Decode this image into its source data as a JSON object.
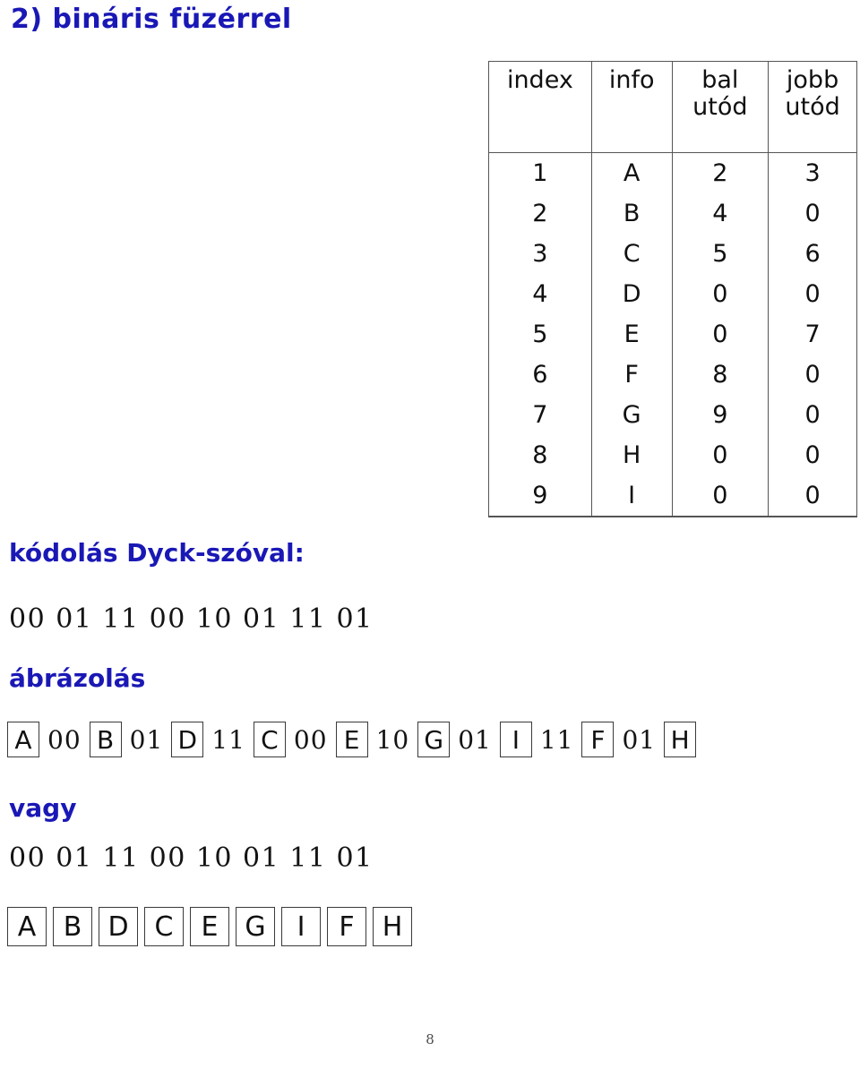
{
  "slide": {
    "title": "2) bináris füzérrel",
    "page_number": "8",
    "accent_color": "#1a18b5",
    "text_color": "#101010"
  },
  "table": {
    "headers": [
      {
        "line1": "index",
        "line2": ""
      },
      {
        "line1": "info",
        "line2": ""
      },
      {
        "line1": "bal",
        "line2": "utód"
      },
      {
        "line1": "jobb",
        "line2": "utód"
      }
    ],
    "rows": [
      {
        "index": "1",
        "info": "A",
        "bal": "2",
        "jobb": "3"
      },
      {
        "index": "2",
        "info": "B",
        "bal": "4",
        "jobb": "0"
      },
      {
        "index": "3",
        "info": "C",
        "bal": "5",
        "jobb": "6"
      },
      {
        "index": "4",
        "info": "D",
        "bal": "0",
        "jobb": "0"
      },
      {
        "index": "5",
        "info": "E",
        "bal": "0",
        "jobb": "7"
      },
      {
        "index": "6",
        "info": "F",
        "bal": "8",
        "jobb": "0"
      },
      {
        "index": "7",
        "info": "G",
        "bal": "9",
        "jobb": "0"
      },
      {
        "index": "8",
        "info": "H",
        "bal": "0",
        "jobb": "0"
      },
      {
        "index": "9",
        "info": "I",
        "bal": "0",
        "jobb": "0"
      }
    ]
  },
  "coding": {
    "heading": "kódolás Dyck-szóval:",
    "dyck_word": "00 01 11 00 10 01 11 01"
  },
  "representation": {
    "heading": "ábrázolás",
    "sequence": [
      {
        "type": "node",
        "value": "A"
      },
      {
        "type": "bits",
        "value": "00"
      },
      {
        "type": "node",
        "value": "B"
      },
      {
        "type": "bits",
        "value": "01"
      },
      {
        "type": "node",
        "value": "D"
      },
      {
        "type": "bits",
        "value": "11"
      },
      {
        "type": "node",
        "value": "C"
      },
      {
        "type": "bits",
        "value": "00"
      },
      {
        "type": "node",
        "value": "E"
      },
      {
        "type": "bits",
        "value": "10"
      },
      {
        "type": "node",
        "value": "G"
      },
      {
        "type": "bits",
        "value": "01"
      },
      {
        "type": "node",
        "value": "I"
      },
      {
        "type": "bits",
        "value": "11"
      },
      {
        "type": "node",
        "value": "F"
      },
      {
        "type": "bits",
        "value": "01"
      },
      {
        "type": "node",
        "value": "H"
      }
    ]
  },
  "alternative": {
    "heading": "vagy",
    "dyck_word": "00 01 11 00 10 01 11 01",
    "nodes": [
      "A",
      "B",
      "D",
      "C",
      "E",
      "G",
      "I",
      "F",
      "H"
    ]
  }
}
